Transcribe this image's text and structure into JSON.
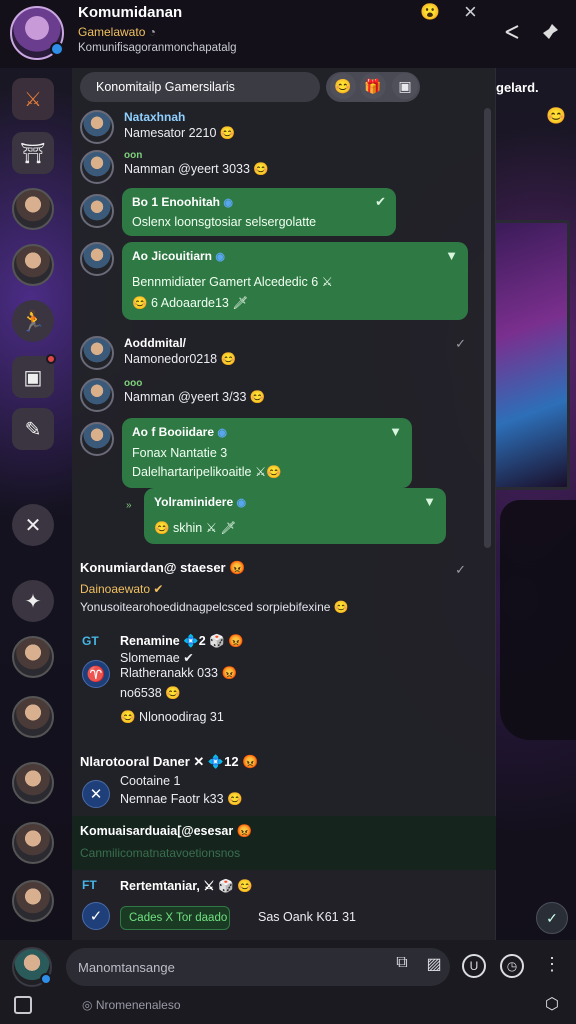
{
  "header": {
    "title": "Komumidanan",
    "subtitle": "Gamelawato",
    "description": "Komunifisagoranmonchapatalg",
    "emoji": "😮",
    "close_glyph": "×"
  },
  "behind": {
    "label": "gelard.",
    "emoji": "😊"
  },
  "tabbar": {
    "search_label": "Konomitailp Gamersilaris",
    "btn1": "😊",
    "btn2": "🎁",
    "btn3": "▣"
  },
  "messages": [
    {
      "name": "Nataxhnah",
      "text": "Namesator 2210 😊"
    },
    {
      "name": "oon",
      "text": "Namman @yeert 3033 😊"
    },
    {
      "bubble_name": "Bo 1 Enoohitah",
      "bubble_text": "Oslenx loonsgtosiar selsergolatte",
      "icon": "✔"
    },
    {
      "bubble_name": "Ao Jicouitiarn",
      "bubble_text1": "Bennmidiater Gamert Alcededic 6 ⚔",
      "bubble_text2": "😊 6 Adoaarde13 🗡",
      "icon": "▼"
    },
    {
      "name": "Aoddmital/",
      "text": "Namonedor0218 😊",
      "check": "✓"
    },
    {
      "name": "ooo",
      "text": "Namman @yeert 3/33 😊"
    },
    {
      "bubble_name": "Ao f Booiidare",
      "bubble_text1": "Fonax Nantatie 3",
      "bubble_text2": "Dalelhartaripelikoaitle ⚔😊",
      "icon": "▼"
    },
    {
      "bubble_name": "Yolraminidere",
      "bubble_text": "😊 skhin ⚔ 🗡",
      "icon": "▼"
    }
  ],
  "section1": {
    "title": "Konumiardan@ staeser 😡",
    "sub1": "Dainoaewato ✔",
    "sub2": "Yonusoitearohoedidnagpelcsced sorpiebifexine 😊"
  },
  "card1": {
    "tag": "GT",
    "line1": "Renamine 💠2 🎲 😡",
    "line2": "Slomemae ✔",
    "line3": "Rlatheranakk 033 😡",
    "line4": "no6538 😊",
    "line5": "😊 Nlonoodirag 31",
    "avatar_glyph": "♈"
  },
  "card2": {
    "title": "Nlarotooral Daner ✕ 💠12 😡",
    "line1": "Cootaine 1",
    "line2": "Nemnae Faotr k33 😊",
    "avatar_glyph": "✕"
  },
  "highlight": {
    "title": "Komuaisarduaia[@esesar 😡",
    "sub": "Canmilicomatnatavoetionsnos"
  },
  "card3": {
    "tag": "FT",
    "line1": "Rertemtaniar, ⚔ 🎲 😊",
    "pill": "Cades X Tor daado",
    "line2": "Sas Oank K61 31",
    "avatar_glyph": "✓",
    "fab": "✓"
  },
  "composer": {
    "placeholder": "Manomtansange",
    "secondary": "Nromenenaleso"
  }
}
